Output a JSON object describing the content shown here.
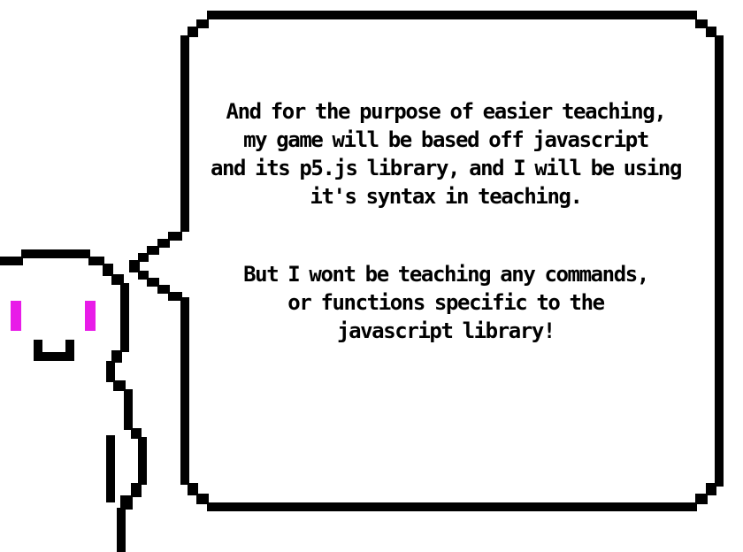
{
  "dialog": {
    "paragraph_1": {
      "lines": [
        "And for the purpose of easier teaching,",
        "my game will be based off javascript",
        "and its p5.js library, and I will be using",
        "it's syntax in teaching."
      ]
    },
    "paragraph_2": {
      "lines": [
        "But I wont be teaching any commands,",
        "or functions specific to the",
        "javascript library!"
      ]
    }
  },
  "character": {
    "eye_color": "#e81ce8",
    "outline_color": "#000000"
  }
}
